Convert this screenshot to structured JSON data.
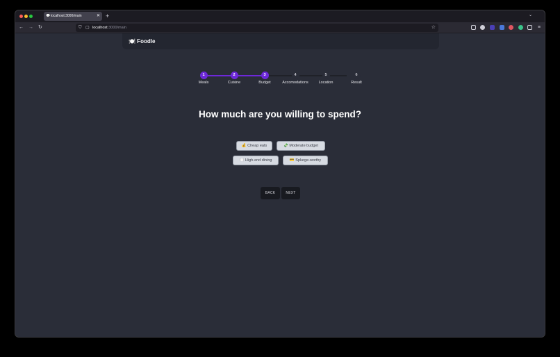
{
  "browser": {
    "tab_title": "localhost:3000/main",
    "tab_icon": "speech-bubble-icon",
    "new_tab": "+",
    "url_host": "localhost",
    "url_path": ":3000/main"
  },
  "app": {
    "brand": "🍽️ Foodle"
  },
  "stepper": {
    "steps": [
      {
        "num": "1",
        "label": "Meals",
        "active": true
      },
      {
        "num": "2",
        "label": "Cuisine",
        "active": true
      },
      {
        "num": "3",
        "label": "Budget",
        "active": true
      },
      {
        "num": "4",
        "label": "Accomodations",
        "active": false
      },
      {
        "num": "5",
        "label": "Location",
        "active": false
      },
      {
        "num": "6",
        "label": "Result",
        "active": false
      }
    ],
    "active_color": "#6d28d9",
    "inactive_color": "#1f2128"
  },
  "question": "How much are you willing to spend?",
  "options": [
    {
      "label": "💰 Cheap eats"
    },
    {
      "label": "💸 Moderate budget"
    },
    {
      "label": "🍽️ High-end dining"
    },
    {
      "label": "💳 Splurge-worthy"
    }
  ],
  "nav": {
    "back": "BACK",
    "next": "NEXT"
  }
}
